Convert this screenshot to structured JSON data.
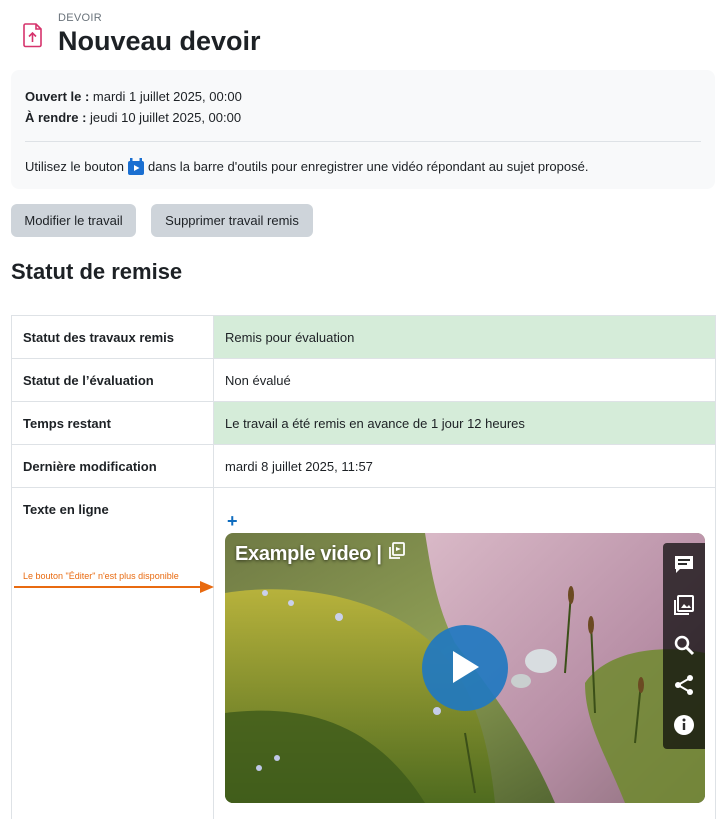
{
  "header": {
    "kicker": "DEVOIR",
    "title": "Nouveau devoir",
    "icon": "assignment-upload-icon",
    "icon_color": "#d6336c"
  },
  "dates": {
    "opened_label": "Ouvert le :",
    "opened_value": "mardi 1 juillet 2025, 00:00",
    "due_label": "À rendre :",
    "due_value": "jeudi 10 juillet 2025, 00:00"
  },
  "instructions": {
    "before": "Utilisez le bouton",
    "after": "dans la barre d'outils pour enregistrer une vidéo répondant au sujet proposé.",
    "icon": "video-record-icon"
  },
  "buttons": {
    "edit": "Modifier le travail",
    "delete": "Supprimer travail remis"
  },
  "section": {
    "title": "Statut de remise"
  },
  "status_rows": [
    {
      "label": "Statut des travaux remis",
      "value": "Remis pour évaluation",
      "highlight": true
    },
    {
      "label": "Statut de l’évaluation",
      "value": "Non évalué",
      "highlight": false
    },
    {
      "label": "Temps restant",
      "value": "Le travail a été remis en avance de 1 jour 12 heures",
      "highlight": true
    },
    {
      "label": "Dernière modification",
      "value": "mardi 8 juillet 2025, 11:57",
      "highlight": false
    },
    {
      "label": "Texte en ligne",
      "value": "",
      "highlight": false
    }
  ],
  "online_text": {
    "expand_symbol": "+",
    "video_title": "Example video |",
    "side_icons": [
      "chat-icon",
      "gallery-icon",
      "search-icon",
      "share-icon",
      "info-icon"
    ]
  },
  "annotation": {
    "text": "Le bouton \"Éditer\" n'est plus disponible",
    "color": "#e86a10"
  },
  "colors": {
    "success_bg": "#d5ecd9",
    "button_bg": "#ced4da",
    "link": "#0f6cbf",
    "play": "#2178c0"
  }
}
